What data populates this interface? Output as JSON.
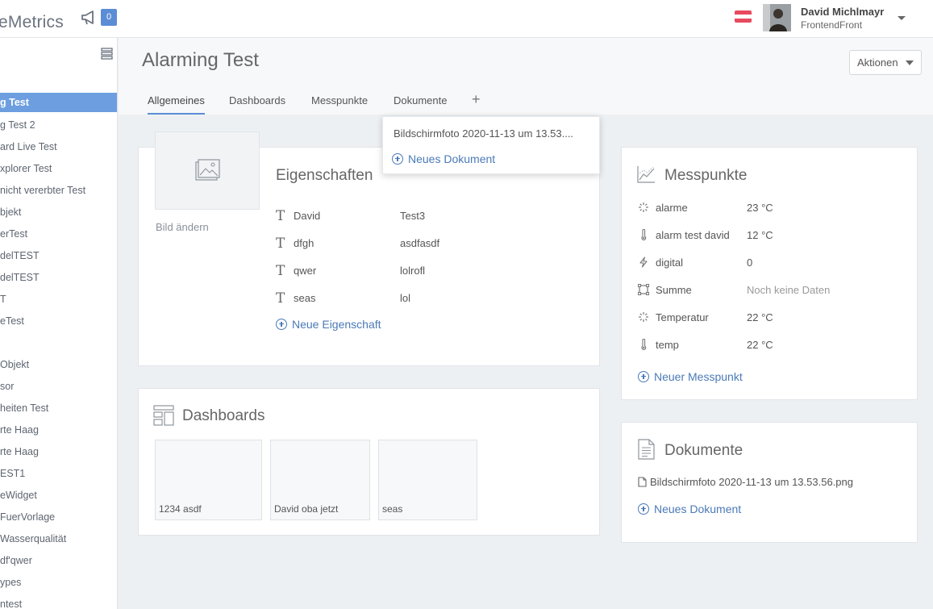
{
  "topbar": {
    "brand": "eMetrics",
    "notification_count": "0",
    "user_name": "David Michlmayr",
    "user_company": "FrontendFront",
    "flag_colors": [
      "#e84a5f",
      "#ffffff",
      "#e84a5f"
    ]
  },
  "sidebar": {
    "items": [
      {
        "label": "g Test",
        "active": true
      },
      {
        "label": "g Test 2"
      },
      {
        "label": "ard Live Test"
      },
      {
        "label": "xplorer Test"
      },
      {
        "label": "nicht vererbter Test"
      },
      {
        "label": "bjekt"
      },
      {
        "label": "erTest"
      },
      {
        "label": "delTEST"
      },
      {
        "label": "delTEST"
      },
      {
        "label": "T"
      },
      {
        "label": "eTest"
      },
      {
        "label": ""
      },
      {
        "label": "Objekt"
      },
      {
        "label": "sor"
      },
      {
        "label": "heiten Test"
      },
      {
        "label": "rte Haag"
      },
      {
        "label": "rte Haag"
      },
      {
        "label": "EST1"
      },
      {
        "label": "eWidget"
      },
      {
        "label": "FuerVorlage"
      },
      {
        "label": "Wasserqualität"
      },
      {
        "label": "df'qwer"
      },
      {
        "label": "ypes"
      },
      {
        "label": "ntest"
      }
    ]
  },
  "header": {
    "title": "Alarming Test",
    "actions_label": "Aktionen",
    "tabs": [
      "Allgemeines",
      "Dashboards",
      "Messpunkte",
      "Dokumente"
    ],
    "tab_add": "+"
  },
  "dropdown": {
    "file": "Bildschirmfoto 2020-11-13 um 13.53....",
    "add_label": "Neues Dokument"
  },
  "properties": {
    "title": "Eigenschaften",
    "change_image": "Bild ändern",
    "rows": [
      {
        "key": "David",
        "value": "Test3"
      },
      {
        "key": "dfgh",
        "value": "asdfasdf"
      },
      {
        "key": "qwer",
        "value": "lolrofl"
      },
      {
        "key": "seas",
        "value": "lol"
      }
    ],
    "add_label": "Neue Eigenschaft"
  },
  "dashboards": {
    "title": "Dashboards",
    "tiles": [
      "1234 asdf",
      "David oba jetzt",
      "seas"
    ]
  },
  "messpunkte": {
    "title": "Messpunkte",
    "rows": [
      {
        "icon": "spinner-icon",
        "name": "alarme",
        "value": "23 °C"
      },
      {
        "icon": "thermometer-icon",
        "name": "alarm test david",
        "value": "12 °C"
      },
      {
        "icon": "lightning-icon",
        "name": "digital",
        "value": "0"
      },
      {
        "icon": "square-sum-icon",
        "name": "Summe",
        "value": "Noch keine Daten",
        "muted": true
      },
      {
        "icon": "spinner-icon",
        "name": "Temperatur",
        "value": "22 °C"
      },
      {
        "icon": "thermometer-icon",
        "name": "temp",
        "value": "22 °C"
      }
    ],
    "add_label": "Neuer Messpunkt"
  },
  "dokumente": {
    "title": "Dokumente",
    "file": "Bildschirmfoto 2020-11-13 um 13.53.56.png",
    "add_label": "Neues Dokument"
  }
}
